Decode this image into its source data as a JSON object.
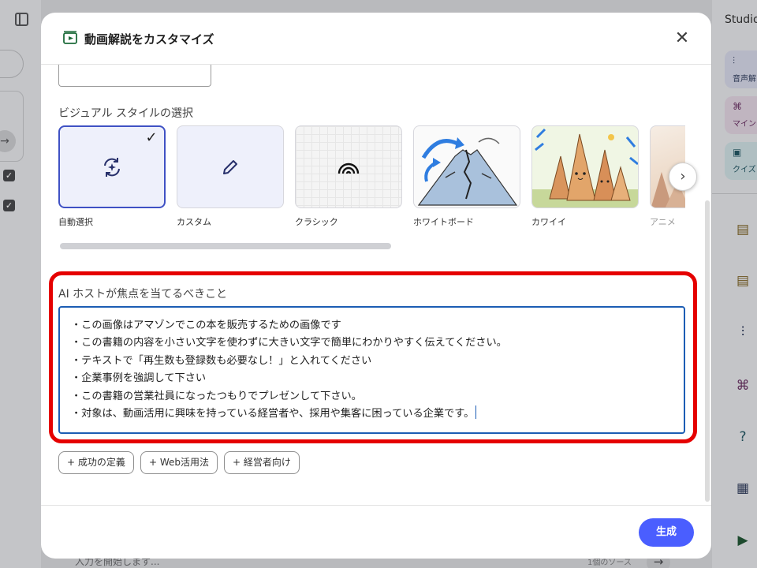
{
  "modal": {
    "title": "動画解説をカスタマイズ",
    "close_label": "✕"
  },
  "visual_style": {
    "section_title": "ビジュアル スタイルの選択",
    "selected_index": 0,
    "cards": [
      {
        "label": "自動選択",
        "icon": "auto-refresh-icon"
      },
      {
        "label": "カスタム",
        "icon": "pencil-icon"
      },
      {
        "label": "クラシック",
        "icon": "rainbow-arc-icon"
      },
      {
        "label": "ホワイトボード",
        "icon": "whiteboard-volcano-image"
      },
      {
        "label": "カワイイ",
        "icon": "kawaii-rocks-image"
      },
      {
        "label": "アニメ",
        "icon": "anime-image"
      }
    ],
    "next_label": "›"
  },
  "focus": {
    "label": "AI ホストが焦点を当てるべきこと",
    "text": "・この画像はアマゾンでこの本を販売するための画像です\n・この書籍の内容を小さい文字を使わずに大きい文字で簡単にわかりやすく伝えてください。\n・テキストで「再生数も登録数も必要なし！」と入れてください\n・企業事例を強調して下さい\n・この書籍の営業社員になったつもりでプレゼンして下さい。\n・対象は、動画活用に興味を持っている経営者や、採用や集客に困っている企業です。",
    "highlight_color": "#e50000"
  },
  "chips": [
    {
      "label": "+ 成功の定義"
    },
    {
      "label": "+ Web活用法"
    },
    {
      "label": "+ 経営者向け"
    }
  ],
  "generate_label": "生成",
  "background": {
    "studio_title": "Studio",
    "studio_tiles": [
      {
        "label": "音声解",
        "icon": "audio-wave-icon"
      },
      {
        "label": "マイン",
        "icon": "mindmap-icon"
      },
      {
        "label": "クイズ",
        "icon": "quiz-icon"
      }
    ],
    "input_placeholder": "入力を開始します...",
    "source_count": "1個のソース",
    "send_label": "→"
  },
  "colors": {
    "accent": "#4a5eff",
    "selected_border": "#3f51c4",
    "textarea_border": "#1b5db4"
  }
}
